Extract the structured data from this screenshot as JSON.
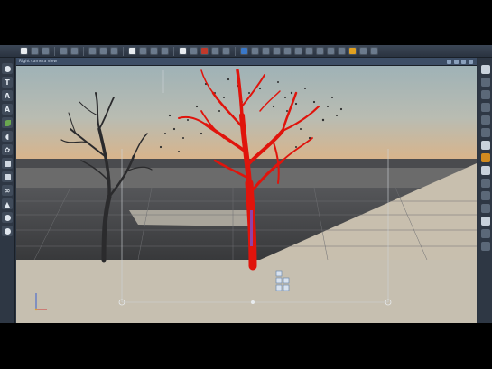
{
  "app": {
    "viewport_title": "Right camera view",
    "toolbar_icons": [
      "new-icon",
      "open-icon",
      "save-icon",
      "undo-icon",
      "redo-icon",
      "cut-icon",
      "copy-icon",
      "paste-icon",
      "select-icon",
      "move-icon",
      "rotate-icon",
      "scale-icon",
      "cloud-icon",
      "render-icon",
      "camera-icon",
      "light-icon",
      "grid-icon",
      "snap-icon",
      "material-icon",
      "preferences-icon"
    ],
    "left_tools": [
      {
        "name": "sphere-tool-icon",
        "glyph": "●"
      },
      {
        "name": "text-tool-icon",
        "glyph": "T"
      },
      {
        "name": "type-tool-icon",
        "glyph": "A"
      },
      {
        "name": "type2-tool-icon",
        "glyph": "A"
      },
      {
        "name": "globe-tool-icon",
        "glyph": "●"
      },
      {
        "name": "sound-tool-icon",
        "glyph": "◖"
      },
      {
        "name": "flower-tool-icon",
        "glyph": "✿"
      },
      {
        "name": "shape-tool-icon",
        "glyph": "▪"
      },
      {
        "name": "page-tool-icon",
        "glyph": "▪"
      },
      {
        "name": "link-tool-icon",
        "glyph": "∞"
      },
      {
        "name": "fire-tool-icon",
        "glyph": "▲"
      }
    ]
  },
  "colors": {
    "selected_tree": "#e0140c",
    "sky_top": "#a6b8bd",
    "sky_horizon": "#d8b48a",
    "ground_dark": "#3f4042",
    "ground_light": "#c8bfae"
  }
}
